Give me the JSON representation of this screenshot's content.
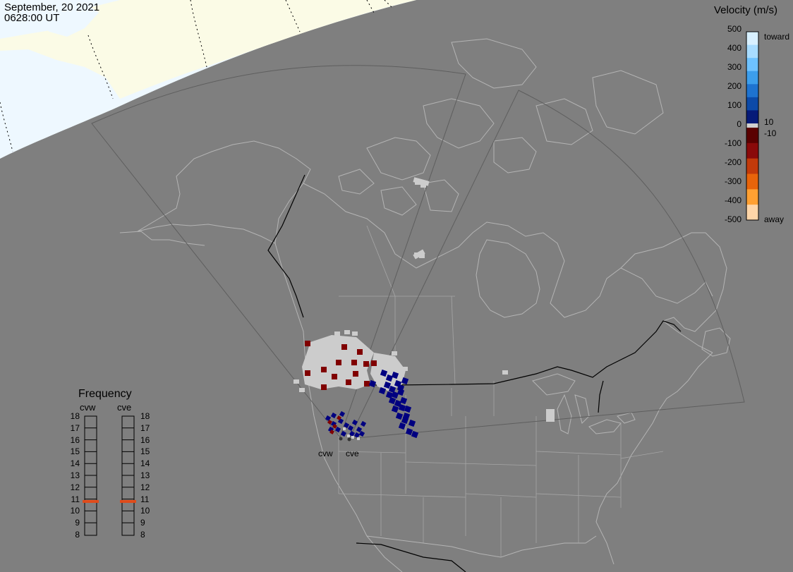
{
  "header": {
    "date": "September, 20 2021",
    "time": "0628:00 UT"
  },
  "colorbar": {
    "title": "Velocity (m/s)",
    "ticks": [
      "500",
      "400",
      "300",
      "200",
      "100",
      "0",
      "-100",
      "-200",
      "-300",
      "-400",
      "-500"
    ],
    "toward_label": "toward",
    "away_label": "away",
    "thresh_pos": "10",
    "thresh_neg": "-10",
    "colors": {
      "toward": [
        "#d8f0ff",
        "#a8dcff",
        "#6ec2ff",
        "#3c9eec",
        "#1e73d0",
        "#0c4aa8",
        "#061a78"
      ],
      "away": [
        "#5a0000",
        "#8a0a0a",
        "#c23a0a",
        "#e8640a",
        "#ffa032",
        "#ffd6a8"
      ],
      "ground": "#d0d0d0"
    }
  },
  "frequency_panel": {
    "title": "Frequency",
    "radars": [
      "cvw",
      "cve"
    ],
    "scale": [
      "18",
      "17",
      "16",
      "15",
      "14",
      "13",
      "12",
      "11",
      "10",
      "9",
      "8"
    ],
    "selected": {
      "cvw": 10.8,
      "cve": 10.8
    },
    "marker_color": "#e04b1a"
  },
  "map": {
    "radar_labels": [
      "cvw",
      "cve"
    ],
    "colors": {
      "background": "#7f7f7f",
      "daylight": "#eef8ff",
      "daylight_land": "#fbfbe6",
      "coast": "#b4b4b4",
      "border": "#000000",
      "fov": "#5a5a5a",
      "positive_velocity": "#000080",
      "negative_velocity": "#800000",
      "ground_scatter": "#cccccc"
    }
  }
}
